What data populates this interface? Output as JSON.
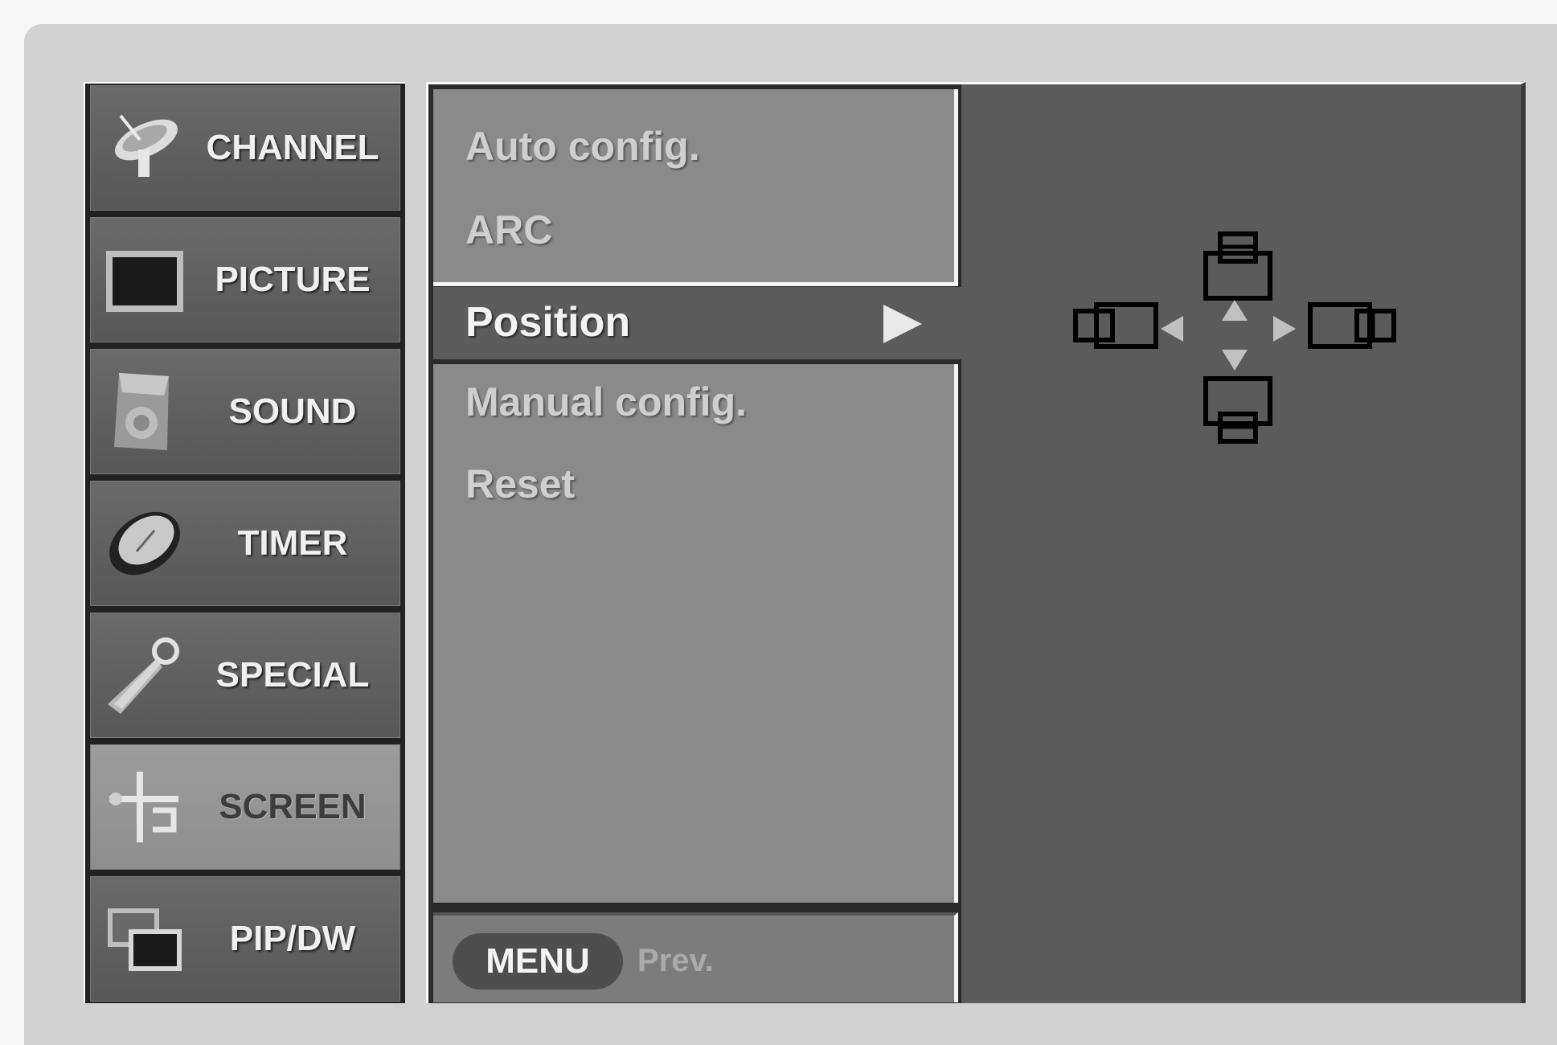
{
  "categories": [
    {
      "label": "CHANNEL",
      "icon": "satellite-dish-icon",
      "active": false
    },
    {
      "label": "PICTURE",
      "icon": "tv-screen-icon",
      "active": false
    },
    {
      "label": "SOUND",
      "icon": "speaker-icon",
      "active": false
    },
    {
      "label": "TIMER",
      "icon": "clock-icon",
      "active": false
    },
    {
      "label": "SPECIAL",
      "icon": "key-icon",
      "active": false
    },
    {
      "label": "SCREEN",
      "icon": "screen-adjust-icon",
      "active": true
    },
    {
      "label": "PIP/DW",
      "icon": "pip-windows-icon",
      "active": false
    }
  ],
  "submenu": {
    "items_above": [
      "Auto config.",
      "ARC"
    ],
    "selected": "Position",
    "items_below": [
      "Manual config.",
      "Reset"
    ]
  },
  "footer": {
    "menu_button": "MENU",
    "hint": "Prev."
  },
  "position_panel": {
    "icons": [
      "move-up-icon",
      "move-down-icon",
      "move-left-icon",
      "move-right-icon"
    ]
  },
  "colors": {
    "frame": "#d1d1d1",
    "category_bg": "#5f5f5f",
    "category_active_bg": "#959595",
    "submenu_bg": "#8a8a8a",
    "selected_bg": "#5c5c5c",
    "right_panel_bg": "#5b5b5b"
  }
}
